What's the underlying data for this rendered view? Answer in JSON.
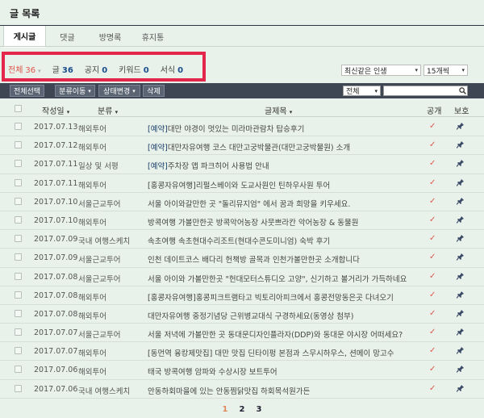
{
  "page": {
    "title": "글 목록"
  },
  "tabs": [
    {
      "label": "게시글",
      "active": true
    },
    {
      "label": "댓글"
    },
    {
      "label": "방명록"
    },
    {
      "label": "휴지통"
    }
  ],
  "filters": [
    {
      "label": "전체",
      "count": "36",
      "active": true,
      "arrow": "▾"
    },
    {
      "label": "글",
      "count": "36"
    },
    {
      "label": "공지",
      "count": "0"
    },
    {
      "label": "키워드",
      "count": "0"
    },
    {
      "label": "서식",
      "count": "0"
    }
  ],
  "sort_select": {
    "value": "최신같은 인생",
    "caret": "▾"
  },
  "per_page_select": {
    "value": "15개씩",
    "caret": "▾"
  },
  "toolbar": {
    "select_all": "전체선택",
    "move_category": "분류이동",
    "change_status": "상태변경",
    "delete": "삭제",
    "caret": "▾",
    "search_scope": "전체",
    "search_value": ""
  },
  "columns": {
    "date": "작성일",
    "date_caret": "▾",
    "category": "분류",
    "category_caret": "▾",
    "title": "글제목",
    "title_caret": "▾",
    "public": "공개",
    "protect": "보호"
  },
  "colors": {
    "accent": "#e0564c",
    "toolbar": "#3d4652",
    "highlight": "#e4264a",
    "background": "#e8f1ea"
  },
  "rows": [
    {
      "date": "2017.07.13",
      "category": "해외투어",
      "tag": "[예약]",
      "title": "대만 야경이 멋있는 미라마관람차 탑승후기",
      "check": "✓"
    },
    {
      "date": "2017.07.12",
      "category": "해외투어",
      "tag": "[예약]",
      "title": "대만자유여행 코스 대만고궁박물관(대만고궁박물원) 소개",
      "check": "✓"
    },
    {
      "date": "2017.07.11",
      "category": "일상 및 서평",
      "tag": "[예약]",
      "title": "주차장 앱 파크히어 사용법 안내",
      "check": "✓"
    },
    {
      "date": "2017.07.11",
      "category": "해외투어",
      "tag": "",
      "title": "[홍콩자유여행]리펄스베이와 도교사원인 틴하우사원 투어",
      "check": "✓"
    },
    {
      "date": "2017.07.10",
      "category": "서울근교투어",
      "tag": "",
      "title": "서울 아이와갈만한 곳 \"돌리뮤지엄\" 에서 꿈과 희망을 키우세요.",
      "check": "✓"
    },
    {
      "date": "2017.07.10",
      "category": "해외투어",
      "tag": "",
      "title": "방콕여행 가볼만한곳 방콕악어농장 사뭇쁘라칸 악어농장 & 동물원",
      "check": "✓"
    },
    {
      "date": "2017.07.09",
      "category": "국내 여행스케치",
      "tag": "",
      "title": "속초여행 속초현대수리조트(현대수콘도미니엄) 숙박 후기",
      "check": "✓"
    },
    {
      "date": "2017.07.09",
      "category": "서울근교투어",
      "tag": "",
      "title": "인천 데이트코스 배다리 헌책방 골목과 인천가볼만한곳 소개합니다",
      "check": "✓"
    },
    {
      "date": "2017.07.08",
      "category": "서울근교투어",
      "tag": "",
      "title": "서울 아이와 가볼만한곳 \"헌대모터스튜디오 고양\", 신기하고 볼거리가 가득하네요",
      "check": "✓"
    },
    {
      "date": "2017.07.08",
      "category": "해외투어",
      "tag": "",
      "title": "[홍콩자유여행]홍콩피크트램타고 빅토리아피크에서 홍콩전망동은곳 다녀오기",
      "check": "✓"
    },
    {
      "date": "2017.07.08",
      "category": "해외투어",
      "tag": "",
      "title": "대만자유여행 중정기념당 근위병교대식 구경하세요(동영상 첨부)",
      "check": "✓"
    },
    {
      "date": "2017.07.07",
      "category": "서울근교투어",
      "tag": "",
      "title": "서울 저녁에 가볼만한 곳 동대문디자인플라자(DDP)와 동대문 야시장 어떠세요?",
      "check": "✓"
    },
    {
      "date": "2017.07.07",
      "category": "해외투어",
      "tag": "",
      "title": "[동먼역 융캉제맛집] 대만 맛집 딘타이펑 본점과 스무시하우스, 션메이 망고수",
      "check": "✓"
    },
    {
      "date": "2017.07.06",
      "category": "해외투어",
      "tag": "",
      "title": "태국 방콕여행 암파와 수상시장 보트투어",
      "check": "✓"
    },
    {
      "date": "2017.07.06",
      "category": "국내 여행스케치",
      "tag": "",
      "title": "안동하회마을에 있는 안동찜닭맛집 하회목석원가든",
      "check": "✓"
    }
  ],
  "pager": {
    "pages": [
      "1",
      "2",
      "3"
    ],
    "current": "1"
  }
}
